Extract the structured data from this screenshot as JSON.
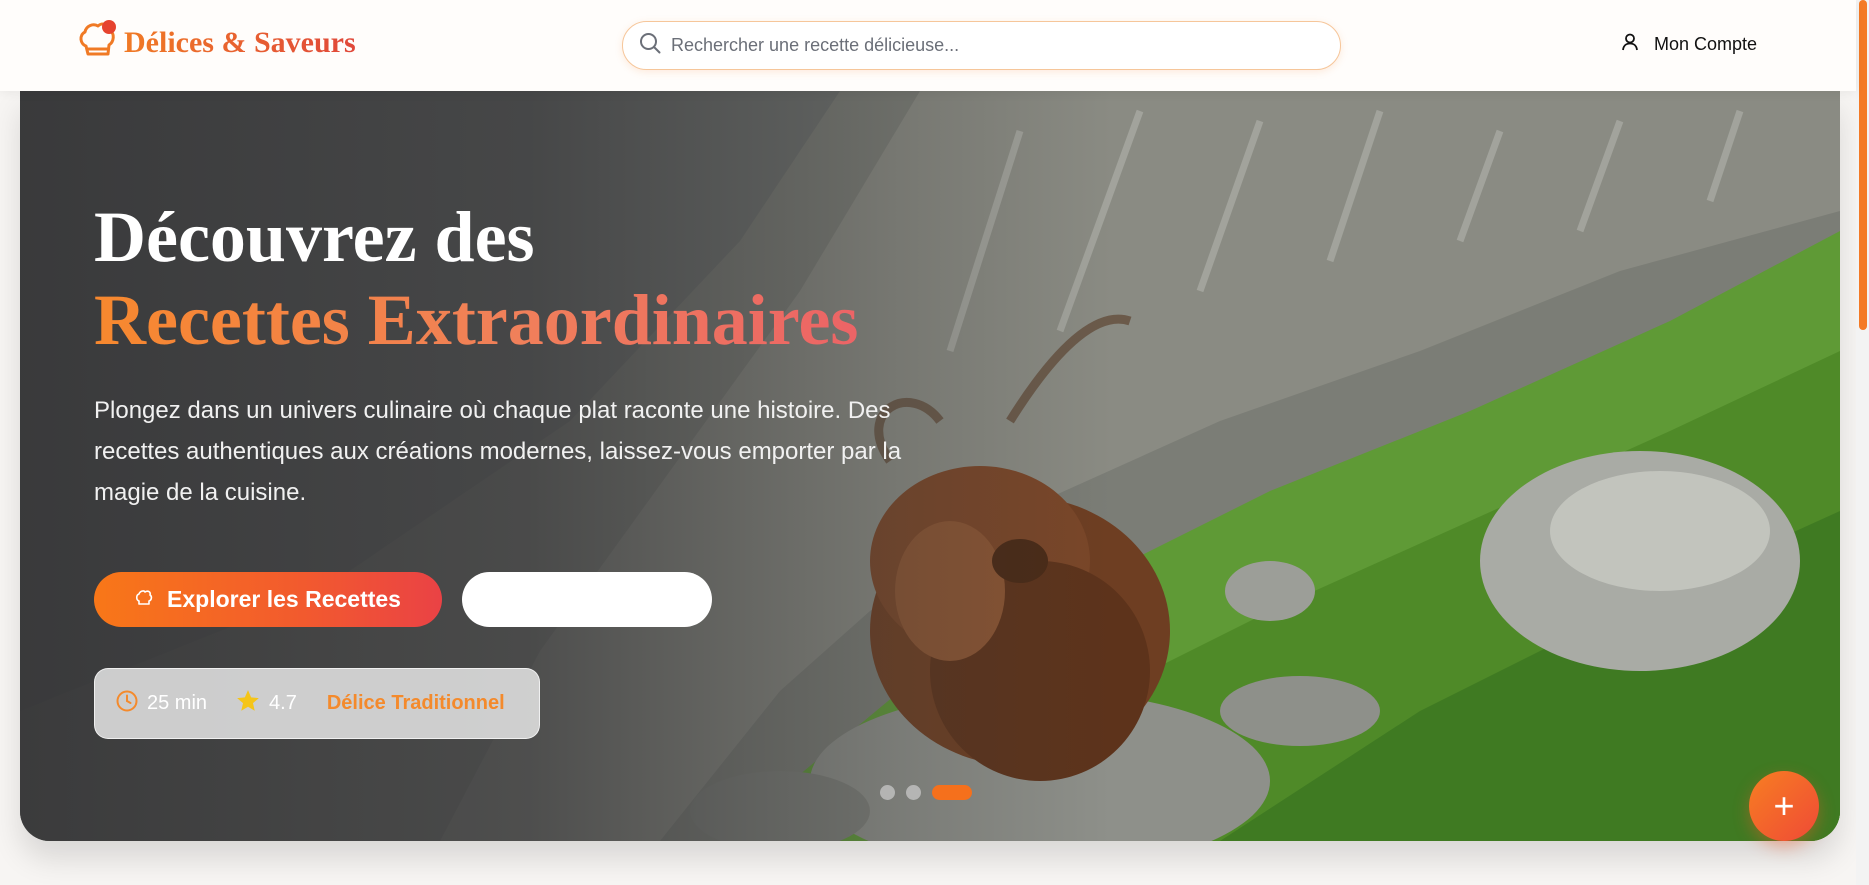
{
  "brand": {
    "name": "Délices & Saveurs",
    "icon": "chef-hat-icon"
  },
  "search": {
    "placeholder": "Rechercher une recette délicieuse...",
    "value": ""
  },
  "account": {
    "label": "Mon Compte",
    "icon": "user-icon"
  },
  "hero": {
    "title_line1": "Découvrez des",
    "title_line2": "Recettes Extraordinaires",
    "description": "Plongez dans un univers culinaire où chaque plat raconte une histoire. Des recettes authentiques aux créations modernes, laissez-vous emporter par la magie de la cuisine.",
    "primary_button": {
      "label": "Explorer les Recettes",
      "icon": "chef-hat-icon"
    },
    "secondary_button": {
      "label": ""
    },
    "meta": {
      "time": "25 min",
      "time_icon": "clock-icon",
      "rating": "4.7",
      "rating_icon": "star-icon",
      "tag": "Délice Traditionnel"
    },
    "carousel": {
      "slides": 3,
      "active_index": 2
    },
    "image_alt": "Highland cow grazing on a steep green mountainside"
  },
  "fab": {
    "icon": "plus-icon",
    "label": "+"
  },
  "colors": {
    "accent": "#f5701c",
    "accent_red": "#e6432f",
    "tag": "#f48a2c",
    "background": "#f7f5f3"
  }
}
